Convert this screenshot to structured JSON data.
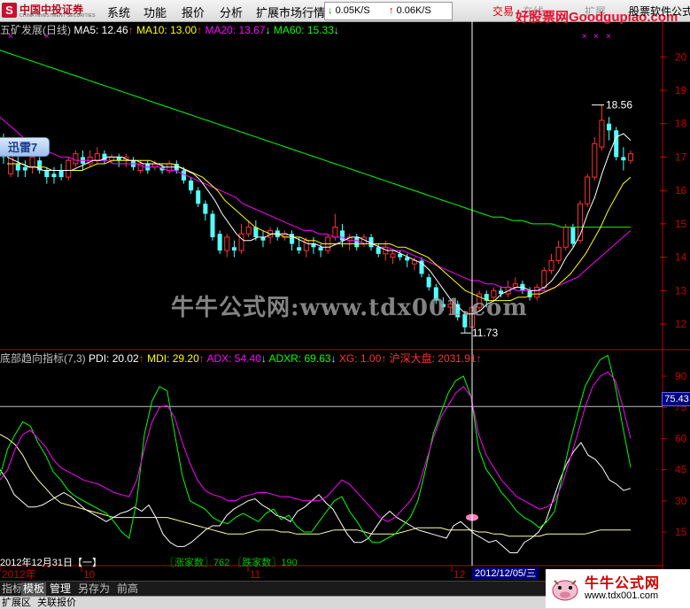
{
  "menubar": {
    "logo_cn": "中国中投证券",
    "logo_en": "CHINA INVESTMENT SECURITIES",
    "items": [
      "系统",
      "功能",
      "报价",
      "分析",
      "扩展市场行情"
    ],
    "speed_down": "0.05K/S",
    "speed_up": "0.06K/S",
    "right_items": [
      "交易",
      "在线",
      "扩展"
    ],
    "watermark_top": "好股票网",
    "watermark_top_en": "Goodgupiao.com",
    "top_right": "股票软件公式"
  },
  "main_chart": {
    "legend": {
      "title": "五矿发展(日线)",
      "ma5": "MA5: 12.46",
      "ma10": "MA10: 13.00",
      "ma20": "MA20: 13.67",
      "ma60": "MA60: 15.33"
    },
    "high_label": "18.56",
    "low_label": "11.73",
    "y_ticks": [
      "20",
      "19",
      "18",
      "17",
      "16",
      "15",
      "14",
      "13",
      "12"
    ],
    "xunlei": "迅雷7",
    "watermark": "牛牛公式网:www.tdx001.com"
  },
  "indicator": {
    "legend": {
      "name": "底部趋向指标(7,3)",
      "pdi": "PDI: 20.02",
      "mdi": "MDI: 29.20",
      "adx": "ADX: 54.40",
      "adxr": "ADXR: 69.63",
      "xg": "XG: 1.00",
      "index": "沪深大盘: 2031.91"
    },
    "y_ticks": [
      "90",
      "75",
      "60",
      "45",
      "30",
      "15"
    ],
    "price_flag": "75.43",
    "rise_fall": "〖涨家数〗762 〖跌家数〗190"
  },
  "x_axis": {
    "date_info": "2012年12月31日【一】",
    "labels": [
      "2012年",
      "10",
      "11",
      "12"
    ],
    "cursor_date": "2012/12/05/三"
  },
  "tabs": [
    "指标",
    "模板",
    "管理",
    "另存为",
    "前高"
  ],
  "statusbar": {
    "items": [
      "扩展区",
      "关联报价"
    ]
  },
  "bottom_logo": {
    "title": "牛牛公式网",
    "url": "www.tdx001.com"
  },
  "colors": {
    "up": "#ff3232",
    "down": "#54ffff",
    "ma5": "#ffffff",
    "ma10": "#ffff00",
    "ma20": "#ff00ff",
    "ma60": "#00ff00",
    "axis": "#c00000"
  },
  "chart_data": {
    "type": "candlestick",
    "title": "五矿发展(日线)",
    "price_axis": [
      12,
      13,
      14,
      15,
      16,
      17,
      18,
      19,
      20
    ],
    "x_labels": [
      "2012年",
      "10",
      "11",
      "12"
    ],
    "candles": [
      {
        "o": 17.4,
        "c": 17.0,
        "h": 17.7,
        "l": 16.8
      },
      {
        "o": 16.5,
        "c": 17.1,
        "h": 17.2,
        "l": 16.4
      },
      {
        "o": 16.8,
        "c": 16.6,
        "h": 17.2,
        "l": 16.4
      },
      {
        "o": 16.7,
        "c": 16.6,
        "h": 16.9,
        "l": 16.4
      },
      {
        "o": 16.7,
        "c": 17.0,
        "h": 17.1,
        "l": 16.5
      },
      {
        "o": 16.9,
        "c": 16.6,
        "h": 17.0,
        "l": 16.5
      },
      {
        "o": 16.6,
        "c": 16.4,
        "h": 16.7,
        "l": 16.2
      },
      {
        "o": 16.5,
        "c": 16.4,
        "h": 16.7,
        "l": 16.2
      },
      {
        "o": 16.6,
        "c": 16.4,
        "h": 16.8,
        "l": 16.3
      },
      {
        "o": 16.4,
        "c": 16.9,
        "h": 17.0,
        "l": 16.3
      },
      {
        "o": 16.8,
        "c": 17.1,
        "h": 17.2,
        "l": 16.7
      },
      {
        "o": 17.0,
        "c": 16.8,
        "h": 17.2,
        "l": 16.6
      },
      {
        "o": 16.8,
        "c": 17.0,
        "h": 17.2,
        "l": 16.7
      },
      {
        "o": 16.9,
        "c": 17.1,
        "h": 17.3,
        "l": 16.8
      },
      {
        "o": 17.1,
        "c": 16.9,
        "h": 17.2,
        "l": 16.8
      },
      {
        "o": 16.9,
        "c": 17.0,
        "h": 17.1,
        "l": 16.8
      },
      {
        "o": 17.0,
        "c": 16.9,
        "h": 17.1,
        "l": 16.7
      },
      {
        "o": 16.9,
        "c": 17.0,
        "h": 17.1,
        "l": 16.7
      },
      {
        "o": 16.9,
        "c": 16.7,
        "h": 17.0,
        "l": 16.6
      },
      {
        "o": 16.6,
        "c": 16.8,
        "h": 16.9,
        "l": 16.5
      },
      {
        "o": 16.8,
        "c": 16.6,
        "h": 16.9,
        "l": 16.5
      },
      {
        "o": 16.7,
        "c": 16.8,
        "h": 16.9,
        "l": 16.6
      },
      {
        "o": 16.7,
        "c": 16.6,
        "h": 16.8,
        "l": 16.5
      },
      {
        "o": 16.6,
        "c": 16.8,
        "h": 16.9,
        "l": 16.5
      },
      {
        "o": 16.8,
        "c": 16.6,
        "h": 16.9,
        "l": 16.5
      },
      {
        "o": 16.6,
        "c": 16.3,
        "h": 16.7,
        "l": 16.2
      },
      {
        "o": 16.3,
        "c": 16.0,
        "h": 16.4,
        "l": 15.9
      },
      {
        "o": 16.0,
        "c": 15.6,
        "h": 16.1,
        "l": 15.5
      },
      {
        "o": 15.6,
        "c": 15.3,
        "h": 15.7,
        "l": 15.1
      },
      {
        "o": 15.3,
        "c": 14.6,
        "h": 15.4,
        "l": 14.5
      },
      {
        "o": 14.7,
        "c": 14.2,
        "h": 14.8,
        "l": 14.1
      },
      {
        "o": 14.2,
        "c": 14.6,
        "h": 14.7,
        "l": 14.0
      },
      {
        "o": 14.3,
        "c": 14.2,
        "h": 14.5,
        "l": 14.0
      },
      {
        "o": 14.2,
        "c": 14.7,
        "h": 15.0,
        "l": 14.1
      },
      {
        "o": 14.7,
        "c": 14.9,
        "h": 15.1,
        "l": 14.6
      },
      {
        "o": 14.9,
        "c": 14.6,
        "h": 15.1,
        "l": 14.5
      },
      {
        "o": 14.6,
        "c": 14.5,
        "h": 14.8,
        "l": 14.3
      },
      {
        "o": 14.6,
        "c": 14.8,
        "h": 14.9,
        "l": 14.4
      },
      {
        "o": 14.8,
        "c": 14.6,
        "h": 14.9,
        "l": 14.5
      },
      {
        "o": 14.6,
        "c": 14.7,
        "h": 14.8,
        "l": 14.5
      },
      {
        "o": 14.7,
        "c": 14.4,
        "h": 14.8,
        "l": 14.2
      },
      {
        "o": 14.3,
        "c": 14.2,
        "h": 14.6,
        "l": 14.1
      },
      {
        "o": 14.2,
        "c": 14.5,
        "h": 14.6,
        "l": 14.0
      },
      {
        "o": 14.4,
        "c": 14.3,
        "h": 14.6,
        "l": 14.1
      },
      {
        "o": 14.3,
        "c": 14.2,
        "h": 14.4,
        "l": 14.0
      },
      {
        "o": 14.2,
        "c": 14.6,
        "h": 14.7,
        "l": 14.1
      },
      {
        "o": 14.6,
        "c": 14.9,
        "h": 15.3,
        "l": 14.5
      },
      {
        "o": 14.8,
        "c": 14.5,
        "h": 15.0,
        "l": 14.3
      },
      {
        "o": 14.5,
        "c": 14.6,
        "h": 14.7,
        "l": 14.2
      },
      {
        "o": 14.6,
        "c": 14.3,
        "h": 14.7,
        "l": 14.2
      },
      {
        "o": 14.4,
        "c": 14.6,
        "h": 14.7,
        "l": 14.3
      },
      {
        "o": 14.6,
        "c": 14.3,
        "h": 14.7,
        "l": 14.2
      },
      {
        "o": 14.3,
        "c": 14.1,
        "h": 14.4,
        "l": 14.0
      },
      {
        "o": 14.1,
        "c": 14.3,
        "h": 14.5,
        "l": 13.9
      },
      {
        "o": 14.0,
        "c": 14.1,
        "h": 14.2,
        "l": 13.8
      },
      {
        "o": 14.1,
        "c": 14.0,
        "h": 14.2,
        "l": 13.9
      },
      {
        "o": 14.0,
        "c": 13.9,
        "h": 14.1,
        "l": 13.7
      },
      {
        "o": 13.8,
        "c": 13.9,
        "h": 14.0,
        "l": 13.6
      },
      {
        "o": 13.9,
        "c": 13.5,
        "h": 14.0,
        "l": 13.4
      },
      {
        "o": 13.4,
        "c": 13.1,
        "h": 13.5,
        "l": 13.0
      },
      {
        "o": 13.1,
        "c": 12.7,
        "h": 13.2,
        "l": 12.6
      },
      {
        "o": 12.6,
        "c": 12.5,
        "h": 12.8,
        "l": 12.4
      },
      {
        "o": 12.5,
        "c": 12.6,
        "h": 12.7,
        "l": 12.3
      },
      {
        "o": 12.6,
        "c": 12.2,
        "h": 12.7,
        "l": 12.1
      },
      {
        "o": 12.3,
        "c": 11.9,
        "h": 12.4,
        "l": 11.73
      },
      {
        "o": 11.9,
        "c": 12.5,
        "h": 12.7,
        "l": 11.8
      },
      {
        "o": 12.5,
        "c": 12.9,
        "h": 13.0,
        "l": 12.4
      },
      {
        "o": 12.9,
        "c": 12.7,
        "h": 13.0,
        "l": 12.5
      },
      {
        "o": 12.8,
        "c": 13.0,
        "h": 13.1,
        "l": 12.7
      },
      {
        "o": 13.0,
        "c": 12.9,
        "h": 13.1,
        "l": 12.8
      },
      {
        "o": 12.9,
        "c": 13.1,
        "h": 13.3,
        "l": 12.8
      },
      {
        "o": 13.1,
        "c": 13.2,
        "h": 13.4,
        "l": 13.0
      },
      {
        "o": 13.2,
        "c": 13.0,
        "h": 13.3,
        "l": 12.9
      },
      {
        "o": 13.0,
        "c": 12.8,
        "h": 13.1,
        "l": 12.7
      },
      {
        "o": 12.8,
        "c": 13.1,
        "h": 13.2,
        "l": 12.7
      },
      {
        "o": 13.1,
        "c": 13.6,
        "h": 13.7,
        "l": 13.0
      },
      {
        "o": 13.6,
        "c": 13.9,
        "h": 14.1,
        "l": 13.5
      },
      {
        "o": 13.9,
        "c": 14.3,
        "h": 14.5,
        "l": 13.8
      },
      {
        "o": 14.3,
        "c": 14.9,
        "h": 15.0,
        "l": 14.2
      },
      {
        "o": 14.9,
        "c": 14.4,
        "h": 15.0,
        "l": 14.3
      },
      {
        "o": 14.5,
        "c": 15.6,
        "h": 15.7,
        "l": 14.4
      },
      {
        "o": 15.6,
        "c": 16.4,
        "h": 16.5,
        "l": 15.5
      },
      {
        "o": 16.4,
        "c": 17.4,
        "h": 17.6,
        "l": 16.3
      },
      {
        "o": 17.3,
        "c": 18.1,
        "h": 18.56,
        "l": 17.2
      },
      {
        "o": 18.0,
        "c": 17.8,
        "h": 18.2,
        "l": 17.5
      },
      {
        "o": 17.8,
        "c": 17.0,
        "h": 17.9,
        "l": 16.9
      },
      {
        "o": 17.0,
        "c": 16.9,
        "h": 17.3,
        "l": 16.6
      },
      {
        "o": 16.9,
        "c": 17.1,
        "h": 17.2,
        "l": 16.8
      }
    ],
    "ma5": [
      17.0,
      16.9,
      16.8,
      16.7,
      16.7,
      16.6,
      16.6,
      16.6,
      16.6,
      16.6,
      16.7,
      16.8,
      16.9,
      16.9,
      17.0,
      17.0,
      17.0,
      16.9,
      16.9,
      16.8,
      16.8,
      16.8,
      16.7,
      16.7,
      16.7,
      16.6,
      16.5,
      16.3,
      16.0,
      15.7,
      15.3,
      15.0,
      14.7,
      14.5,
      14.5,
      14.6,
      14.6,
      14.7,
      14.7,
      14.7,
      14.6,
      14.5,
      14.4,
      14.4,
      14.3,
      14.3,
      14.4,
      14.5,
      14.6,
      14.6,
      14.5,
      14.4,
      14.3,
      14.2,
      14.2,
      14.1,
      14.0,
      13.9,
      13.8,
      13.6,
      13.3,
      13.0,
      12.7,
      12.5,
      12.3,
      12.3,
      12.4,
      12.6,
      12.7,
      12.9,
      13.0,
      13.1,
      13.1,
      13.0,
      13.0,
      13.1,
      13.3,
      13.6,
      14.0,
      14.3,
      14.7,
      15.3,
      15.8,
      16.5,
      17.1,
      17.6,
      17.7,
      17.5
    ],
    "ma10": [
      16.8,
      16.8,
      16.8,
      16.7,
      16.7,
      16.7,
      16.6,
      16.6,
      16.6,
      16.6,
      16.6,
      16.7,
      16.8,
      16.8,
      16.9,
      16.9,
      16.9,
      16.9,
      16.9,
      16.9,
      16.8,
      16.8,
      16.8,
      16.7,
      16.6,
      16.5,
      16.4,
      16.2,
      16.0,
      15.7,
      15.5,
      15.3,
      15.1,
      14.9,
      14.8,
      14.7,
      14.7,
      14.6,
      14.6,
      14.6,
      14.5,
      14.5,
      14.4,
      14.4,
      14.4,
      14.4,
      14.4,
      14.4,
      14.4,
      14.4,
      14.4,
      14.4,
      14.3,
      14.3,
      14.2,
      14.1,
      14.0,
      13.8,
      13.6,
      13.4,
      13.2,
      13.0,
      12.9,
      12.8,
      12.7,
      12.7,
      12.7,
      12.7,
      12.8,
      12.8,
      12.9,
      12.9,
      13.0,
      13.1,
      13.3,
      13.5,
      13.8,
      14.1,
      14.5,
      14.9,
      15.4,
      15.8,
      16.2,
      16.4
    ],
    "ma20": [
      18.2,
      18.0,
      17.8,
      17.6,
      17.4,
      17.3,
      17.2,
      17.1,
      17.0,
      17.0,
      16.9,
      16.9,
      16.9,
      16.9,
      16.9,
      16.8,
      16.8,
      16.8,
      16.8,
      16.7,
      16.7,
      16.7,
      16.6,
      16.6,
      16.5,
      16.4,
      16.3,
      16.2,
      16.1,
      16.0,
      15.9,
      15.8,
      15.6,
      15.5,
      15.4,
      15.3,
      15.2,
      15.1,
      15.0,
      14.9,
      14.8,
      14.8,
      14.7,
      14.7,
      14.6,
      14.6,
      14.5,
      14.5,
      14.4,
      14.4,
      14.3,
      14.3,
      14.2,
      14.2,
      14.1,
      14.0,
      13.9,
      13.8,
      13.7,
      13.6,
      13.5,
      13.4,
      13.3,
      13.3,
      13.2,
      13.2,
      13.1,
      13.1,
      13.0,
      13.0,
      13.0,
      13.0,
      13.0,
      13.1,
      13.2,
      13.3,
      13.4,
      13.6,
      13.8,
      14.0,
      14.2,
      14.4,
      14.6,
      14.8
    ],
    "ma60": [
      20.2,
      20.1,
      20.0,
      19.9,
      19.8,
      19.7,
      19.6,
      19.5,
      19.4,
      19.3,
      19.2,
      19.1,
      19.0,
      18.9,
      18.8,
      18.7,
      18.6,
      18.5,
      18.4,
      18.3,
      18.2,
      18.1,
      18.0,
      17.9,
      17.8,
      17.7,
      17.6,
      17.5,
      17.4,
      17.3,
      17.2,
      17.1,
      17.0,
      16.9,
      16.8,
      16.7,
      16.6,
      16.5,
      16.4,
      16.3,
      16.2,
      16.1,
      16.0,
      15.9,
      15.8,
      15.7,
      15.6,
      15.5,
      15.4,
      15.3,
      15.2,
      15.2,
      15.1,
      15.1,
      15.0,
      15.0,
      15.0,
      14.9,
      14.9,
      14.9,
      14.9,
      14.9,
      14.9,
      14.9,
      14.9
    ],
    "indicator": {
      "name": "底部趋向指标(7,3)",
      "y_axis": [
        15,
        30,
        45,
        60,
        75,
        90
      ],
      "pdi": [
        45,
        40,
        33,
        30,
        27,
        27,
        28,
        30,
        32,
        34,
        32,
        29,
        26,
        24,
        22,
        20,
        22,
        24,
        25,
        27,
        25,
        28,
        22,
        14,
        10,
        8,
        8,
        10,
        13,
        16,
        18,
        18,
        23,
        26,
        28,
        30,
        31,
        28,
        26,
        23,
        22,
        20,
        25,
        27,
        30,
        33,
        29,
        26,
        20,
        14,
        10,
        10,
        12,
        17,
        22,
        25,
        22,
        20,
        18,
        16,
        15,
        14,
        13,
        12,
        18,
        20,
        17,
        14,
        12,
        10,
        11,
        8,
        5,
        5,
        10,
        12,
        15,
        20,
        30,
        40,
        48,
        54,
        58,
        52,
        50,
        46,
        40,
        38,
        35,
        36
      ],
      "mdi": [
        42,
        55,
        62,
        68,
        66,
        58,
        52,
        44,
        40,
        35,
        32,
        30,
        28,
        26,
        24,
        20,
        15,
        12,
        30,
        62,
        78,
        85,
        83,
        62,
        42,
        30,
        28,
        26,
        22,
        20,
        19,
        22,
        24,
        22,
        20,
        24,
        26,
        21,
        23,
        18,
        15,
        15,
        20,
        25,
        30,
        32,
        25,
        20,
        14,
        10,
        10,
        12,
        14,
        18,
        22,
        30,
        45,
        62,
        72,
        82,
        88,
        90,
        80,
        55,
        45,
        40,
        34,
        30,
        25,
        22,
        20,
        17,
        20,
        25,
        42,
        58,
        72,
        85,
        92,
        98,
        100,
        85,
        65,
        46
      ],
      "adx": [
        40,
        45,
        55,
        62,
        64,
        60,
        56,
        50,
        46,
        44,
        42,
        40,
        39,
        38,
        36,
        34,
        33,
        32,
        40,
        55,
        68,
        75,
        76,
        70,
        58,
        48,
        40,
        35,
        33,
        32,
        30,
        30,
        32,
        33,
        34,
        34,
        33,
        32,
        32,
        31,
        30,
        30,
        30,
        32,
        36,
        40,
        38,
        34,
        30,
        26,
        22,
        20,
        22,
        26,
        30,
        36,
        48,
        60,
        70,
        76,
        82,
        85,
        80,
        62,
        52,
        46,
        40,
        36,
        32,
        30,
        28,
        26,
        27,
        30,
        38,
        50,
        62,
        75,
        85,
        90,
        92,
        88,
        75,
        60
      ],
      "adxr": [
        62,
        60,
        57,
        52,
        45,
        40,
        36,
        32,
        29,
        28,
        27,
        26,
        25,
        24,
        23,
        22,
        22,
        22,
        22,
        22,
        22,
        22,
        22,
        21,
        20,
        19,
        18,
        17,
        16,
        15,
        14,
        14,
        14,
        15,
        16,
        16,
        16,
        15,
        15,
        14,
        14,
        14,
        14,
        15,
        16,
        16,
        16,
        16,
        15,
        14,
        14,
        14,
        14,
        15,
        16,
        17,
        17,
        17,
        17,
        16,
        16,
        16,
        16,
        15,
        15,
        14,
        14,
        13,
        13,
        13,
        13,
        13,
        14,
        14,
        14,
        14,
        14,
        14,
        15,
        16,
        16,
        16,
        16,
        16
      ]
    }
  }
}
